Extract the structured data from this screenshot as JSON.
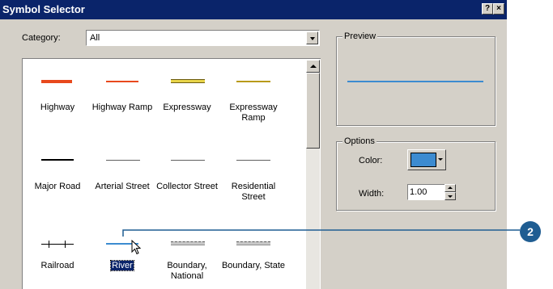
{
  "window": {
    "title": "Symbol Selector",
    "help_button": "?",
    "close_button": "×"
  },
  "category": {
    "label": "Category:",
    "value": "All"
  },
  "symbols": [
    {
      "label": "Highway",
      "color": "#e8491d",
      "style": "thick"
    },
    {
      "label": "Highway Ramp",
      "color": "#e8491d",
      "style": "medium"
    },
    {
      "label": "Expressway",
      "color": "#9a8a1a",
      "style": "double-cased"
    },
    {
      "label": "Expressway Ramp",
      "color": "#b89a1a",
      "style": "thin"
    },
    {
      "label": "Major Road",
      "color": "#000000",
      "style": "medium"
    },
    {
      "label": "Arterial Street",
      "color": "#606060",
      "style": "thin"
    },
    {
      "label": "Collector Street",
      "color": "#606060",
      "style": "thin"
    },
    {
      "label": "Residential Street",
      "color": "#606060",
      "style": "thin"
    },
    {
      "label": "Railroad",
      "color": "#000000",
      "style": "railroad"
    },
    {
      "label": "River",
      "color": "#3c8bd0",
      "style": "thin-blue",
      "selected": true
    },
    {
      "label": "Boundary, National",
      "color": "#808080",
      "style": "boundary"
    },
    {
      "label": "Boundary, State",
      "color": "#808080",
      "style": "boundary"
    }
  ],
  "preview": {
    "label": "Preview",
    "line_color": "#3c8bd0"
  },
  "options": {
    "label": "Options",
    "color_label": "Color:",
    "color_value": "#3c8bd0",
    "width_label": "Width:",
    "width_value": "1.00"
  },
  "callout": {
    "number": "2"
  }
}
